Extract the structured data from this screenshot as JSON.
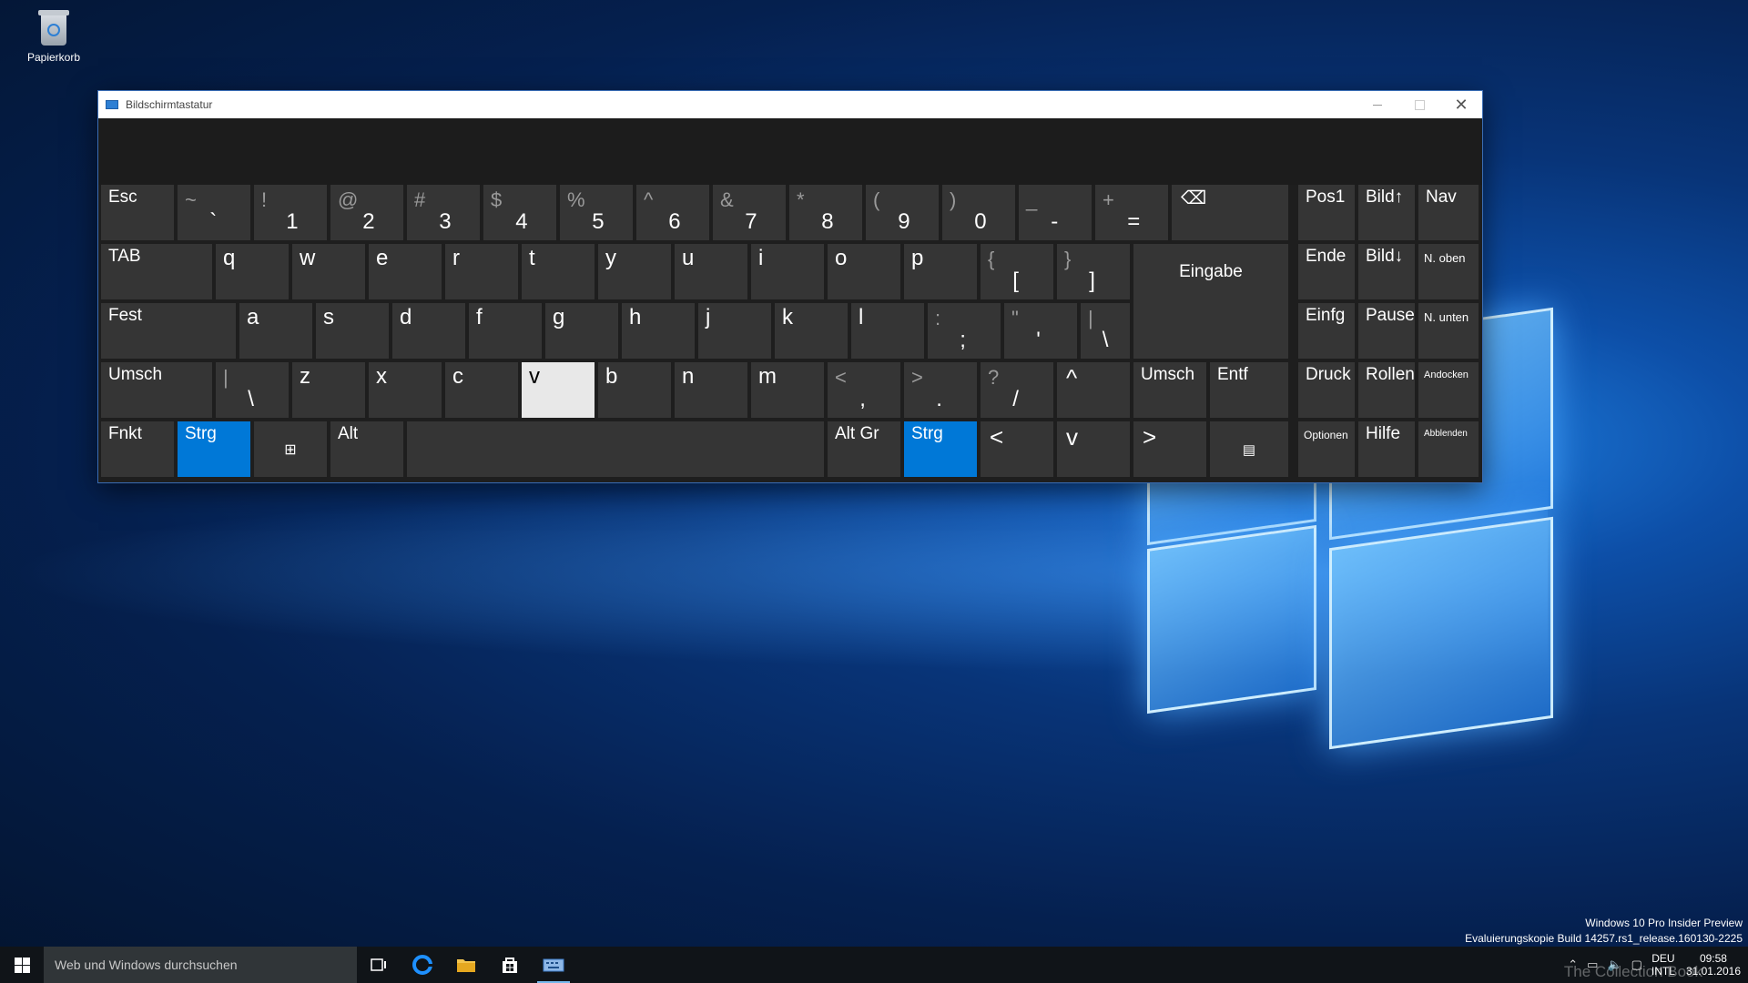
{
  "desktop": {
    "recycle_bin_label": "Papierkorb"
  },
  "window": {
    "title": "Bildschirmtastatur",
    "minimize": "—",
    "maximize": "☐",
    "close": "✕"
  },
  "keys": {
    "esc": "Esc",
    "tilde_shift": "~",
    "tilde_main": "`",
    "k1_shift": "!",
    "k1": "1",
    "k2_shift": "@",
    "k2": "2",
    "k3_shift": "#",
    "k3": "3",
    "k4_shift": "$",
    "k4": "4",
    "k5_shift": "%",
    "k5": "5",
    "k6_shift": "^",
    "k6": "6",
    "k7_shift": "&",
    "k7": "7",
    "k8_shift": "*",
    "k8": "8",
    "k9_shift": "(",
    "k9": "9",
    "k0_shift": ")",
    "k0": "0",
    "minus_shift": "_",
    "minus": "-",
    "equal_shift": "+",
    "equal": "=",
    "backspace": "⌫",
    "tab": "TAB",
    "q": "q",
    "w": "w",
    "e": "e",
    "r": "r",
    "t": "t",
    "y": "y",
    "u": "u",
    "i": "i",
    "o": "o",
    "p": "p",
    "lbracket_shift": "{",
    "lbracket": "[",
    "rbracket_shift": "}",
    "rbracket": "]",
    "enter": "Eingabe",
    "caps": "Fest",
    "a": "a",
    "s": "s",
    "d": "d",
    "f": "f",
    "g": "g",
    "h": "h",
    "j": "j",
    "k": "k",
    "l": "l",
    "semicolon_shift": ":",
    "semicolon": ";",
    "quote_shift": "\"",
    "quote": "'",
    "bslash_shift": "|",
    "bslash": "\\",
    "lshift": "Umsch",
    "oem_shift": "|",
    "oem": "\\",
    "z": "z",
    "x": "x",
    "c": "c",
    "v": "v",
    "b": "b",
    "n": "n",
    "m": "m",
    "comma_shift": "<",
    "comma": ",",
    "period_shift": ">",
    "period": ".",
    "slash_shift": "?",
    "slash": "/",
    "up": "^",
    "rshift": "Umsch",
    "del": "Entf",
    "fn": "Fnkt",
    "lctrl": "Strg",
    "win": "⊞",
    "alt": "Alt",
    "altgr": "Alt Gr",
    "rctrl": "Strg",
    "left": "<",
    "down": "v",
    "right": ">",
    "menu": "▤",
    "home": "Pos1",
    "pgup": "Bild↑",
    "nav": "Nav",
    "end": "Ende",
    "pgdn": "Bild↓",
    "nup": "N. oben",
    "ins": "Einfg",
    "pause": "Pause",
    "ndown": "N. unten",
    "prtsc": "Druck",
    "scroll": "Rollen",
    "dock": "Andocken",
    "options": "Optionen",
    "help": "Hilfe",
    "fade": "Abblenden"
  },
  "taskbar": {
    "search_placeholder": "Web und Windows durchsuchen",
    "lang_top": "DEU",
    "lang_bottom": "INTL",
    "time": "09:58",
    "date": "31.01.2016"
  },
  "watermark": {
    "line1": "Windows 10 Pro Insider Preview",
    "line2": "Evaluierungskopie Build 14257.rs1_release.160130-2225",
    "brand": "The Collection Book"
  },
  "colors": {
    "accent": "#0078d7",
    "key": "#353535",
    "pressed": "#e8e8e8"
  }
}
